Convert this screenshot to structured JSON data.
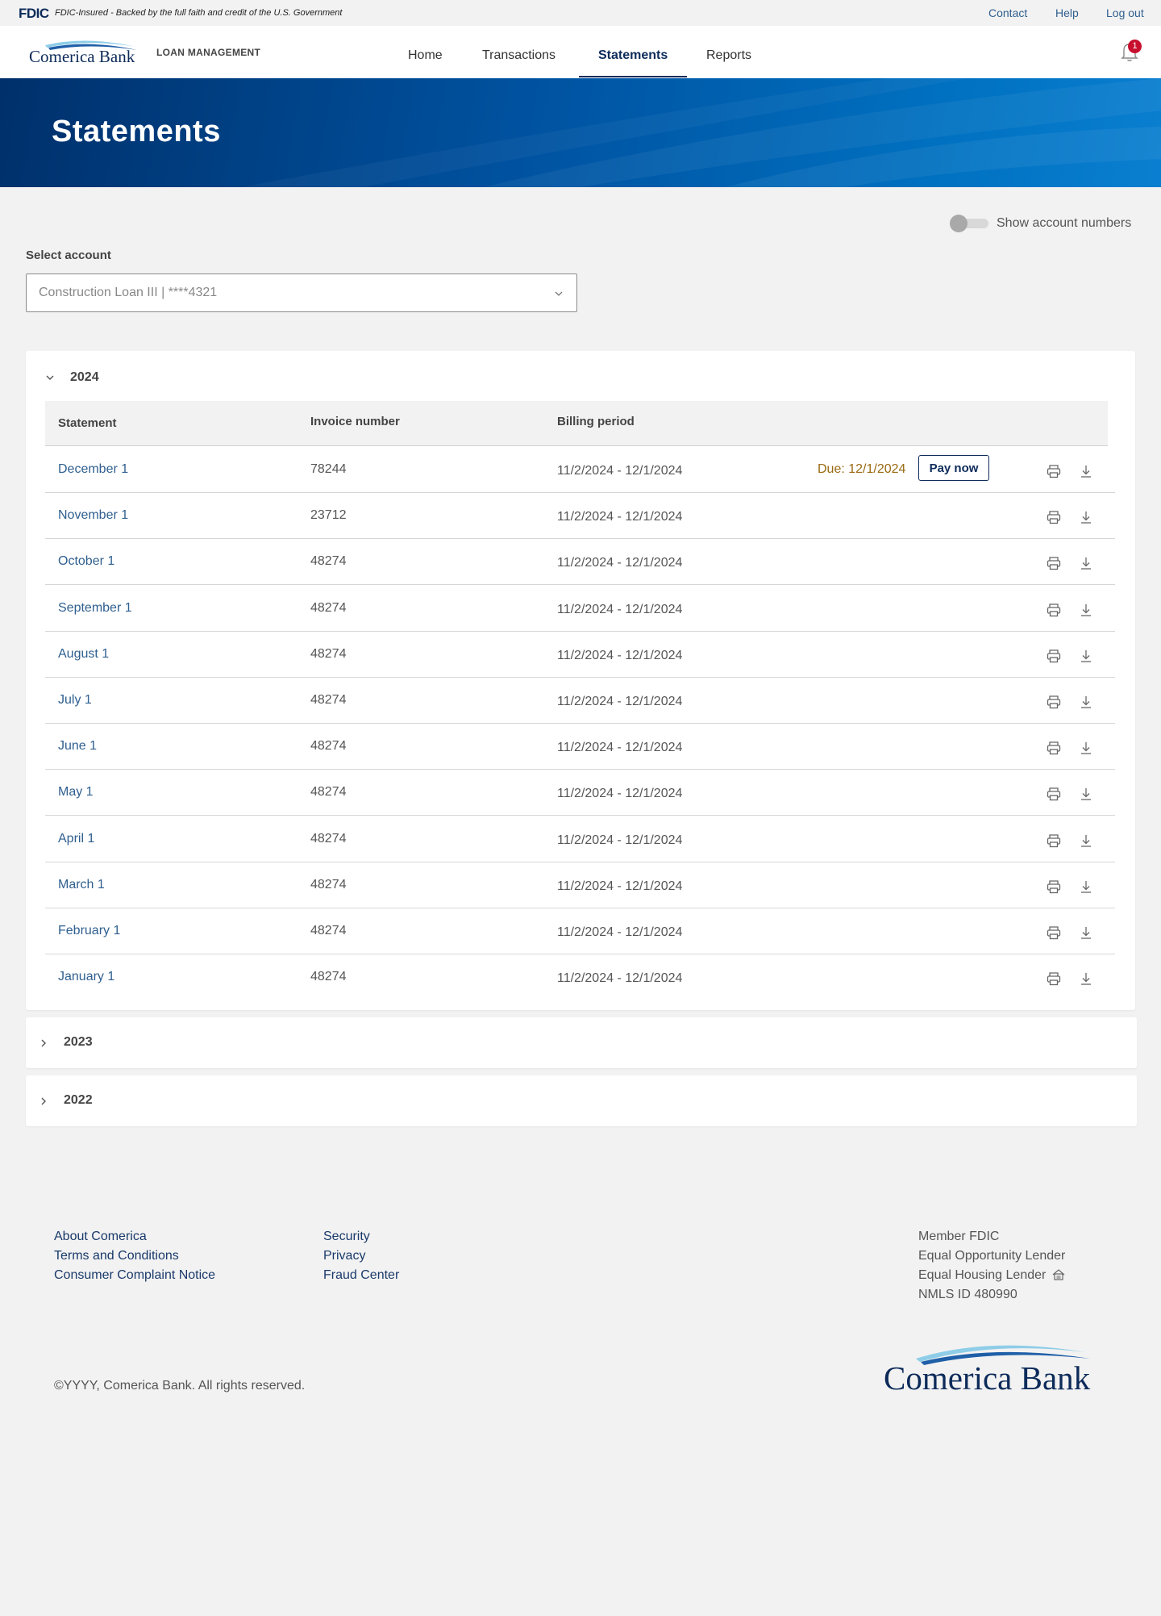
{
  "fdic": {
    "logo": "FDIC",
    "notice": "FDIC-Insured - Backed by the full faith and credit of the U.S. Government"
  },
  "utility_nav": {
    "contact": "Contact",
    "help": "Help",
    "logout": "Log out"
  },
  "header": {
    "logo_text": "Comerica Bank",
    "subtitle": "LOAN MANAGEMENT",
    "nav": [
      "Home",
      "Transactions",
      "Statements",
      "Reports"
    ],
    "active_nav": "Statements",
    "notification_count": "1"
  },
  "hero": {
    "title": "Statements"
  },
  "account_toggle": {
    "label": "Show account numbers",
    "on": false
  },
  "account_select": {
    "label": "Select account",
    "value": "Construction Loan III | ****4321"
  },
  "table": {
    "headers": {
      "statement": "Statement",
      "invoice": "Invoice number",
      "billing": "Billing period"
    }
  },
  "years": [
    {
      "year": "2024",
      "expanded": true,
      "rows": [
        {
          "statement": "December 1",
          "invoice": "78244",
          "billing": "11/2/2024 - 12/1/2024",
          "due": "Due: 12/1/2024",
          "pay_label": "Pay now"
        },
        {
          "statement": "November 1",
          "invoice": "23712",
          "billing": "11/2/2024 - 12/1/2024"
        },
        {
          "statement": "October 1",
          "invoice": "48274",
          "billing": "11/2/2024 - 12/1/2024"
        },
        {
          "statement": "September 1",
          "invoice": "48274",
          "billing": "11/2/2024 - 12/1/2024"
        },
        {
          "statement": "August 1",
          "invoice": "48274",
          "billing": "11/2/2024 - 12/1/2024"
        },
        {
          "statement": "July 1",
          "invoice": "48274",
          "billing": "11/2/2024 - 12/1/2024"
        },
        {
          "statement": "June 1",
          "invoice": "48274",
          "billing": "11/2/2024 - 12/1/2024"
        },
        {
          "statement": "May 1",
          "invoice": "48274",
          "billing": "11/2/2024 - 12/1/2024"
        },
        {
          "statement": "April 1",
          "invoice": "48274",
          "billing": "11/2/2024 - 12/1/2024"
        },
        {
          "statement": "March 1",
          "invoice": "48274",
          "billing": "11/2/2024 - 12/1/2024"
        },
        {
          "statement": "February 1",
          "invoice": "48274",
          "billing": "11/2/2024 - 12/1/2024"
        },
        {
          "statement": "January 1",
          "invoice": "48274",
          "billing": "11/2/2024 - 12/1/2024"
        }
      ]
    },
    {
      "year": "2023",
      "expanded": false
    },
    {
      "year": "2022",
      "expanded": false
    }
  ],
  "footer": {
    "col1": [
      "About Comerica",
      "Terms and Conditions",
      "Consumer Complaint Notice"
    ],
    "col2": [
      "Security",
      "Privacy",
      "Fraud Center"
    ],
    "col3": [
      "Member FDIC",
      "Equal Opportunity Lender",
      "Equal Housing Lender",
      "NMLS ID 480990"
    ],
    "copyright": "©YYYY, Comerica Bank. All rights reserved.",
    "logo_text": "Comerica Bank"
  },
  "colors": {
    "brand_navy": "#0d2b5a",
    "link_blue": "#2f5f8f",
    "due_gold": "#9a6a12",
    "badge_red": "#c8102e"
  },
  "icons": [
    "bell-icon",
    "chevron-down-icon",
    "chevron-right-icon",
    "printer-icon",
    "download-icon",
    "equal-housing-icon"
  ]
}
